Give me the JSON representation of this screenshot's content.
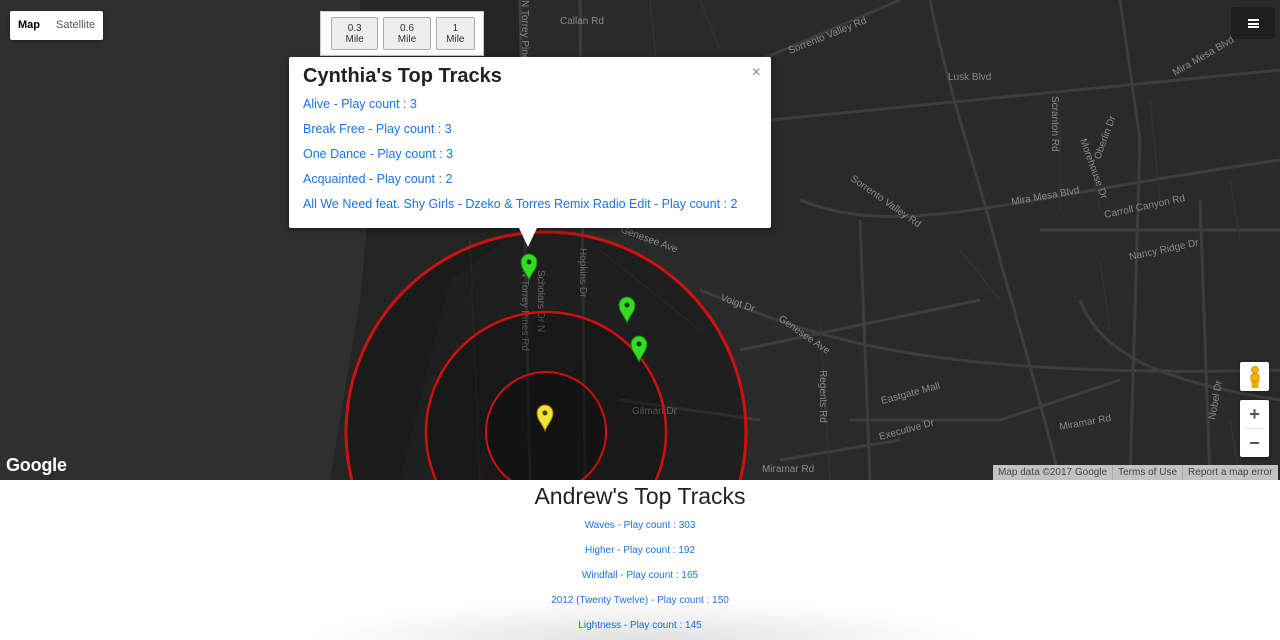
{
  "map_type": {
    "map_label": "Map",
    "satellite_label": "Satellite",
    "active": "Map"
  },
  "radius_buttons": [
    "0.3 Mile",
    "0.6 Mile",
    "1 Mile"
  ],
  "infowindow": {
    "title": "Cynthia's Top Tracks",
    "close_label": "×",
    "tracks": [
      "Alive - Play count : 3",
      "Break Free - Play count : 3",
      "One Dance - Play count : 3",
      "Acquainted - Play count : 2",
      "All We Need feat. Shy Girls - Dzeko & Torres Remix Radio Edit - Play count : 2"
    ]
  },
  "map_labels": {
    "sorrento_valley_rd": "Sorrento Valley Rd",
    "lusk_blvd": "Lusk Blvd",
    "mira_mesa_blvd": "Mira Mesa Blvd",
    "carroll_canyon_rd": "Carroll Canyon Rd",
    "genesee_ave": "Genesee Ave",
    "eastgate_mall": "Eastgate Mall",
    "miramar_rd": "Miramar Rd",
    "executive_dr": "Executive Dr",
    "nancy_ridge_dr": "Nancy Ridge Dr",
    "voigt_dr": "Voigt Dr",
    "regents_rd": "Regents Rd",
    "gilman_dr": "Gilman Dr",
    "n_torrey_pines_rd": "N Torrey Pines Rd",
    "callan_rd": "Callan Rd",
    "scholars_dr": "Scholars Dr N",
    "hopkins_dr": "Hopkins Dr",
    "scranton_rd": "Scranton Rd",
    "morehouse_dr": "Morehouse Dr",
    "oberlin_dr": "Oberlin Dr",
    "nobel_dr": "Nobel Dr"
  },
  "map_controls": {
    "zoom_in": "+",
    "zoom_out": "−"
  },
  "google_logo": "Google",
  "attribution": [
    "Map data ©2017 Google",
    "Terms of Use",
    "Report a map error"
  ],
  "marker_colors": {
    "friends": "#33dd22",
    "user": "#f2e33b",
    "radius": "#d01010"
  },
  "andrew": {
    "title": "Andrew's Top Tracks",
    "tracks": [
      "Waves - Play count : 303",
      "Higher - Play count : 192",
      "Windfall - Play count : 165",
      "2012 (Twenty Twelve) - Play count : 150",
      "Lightness - Play count : 145"
    ]
  }
}
